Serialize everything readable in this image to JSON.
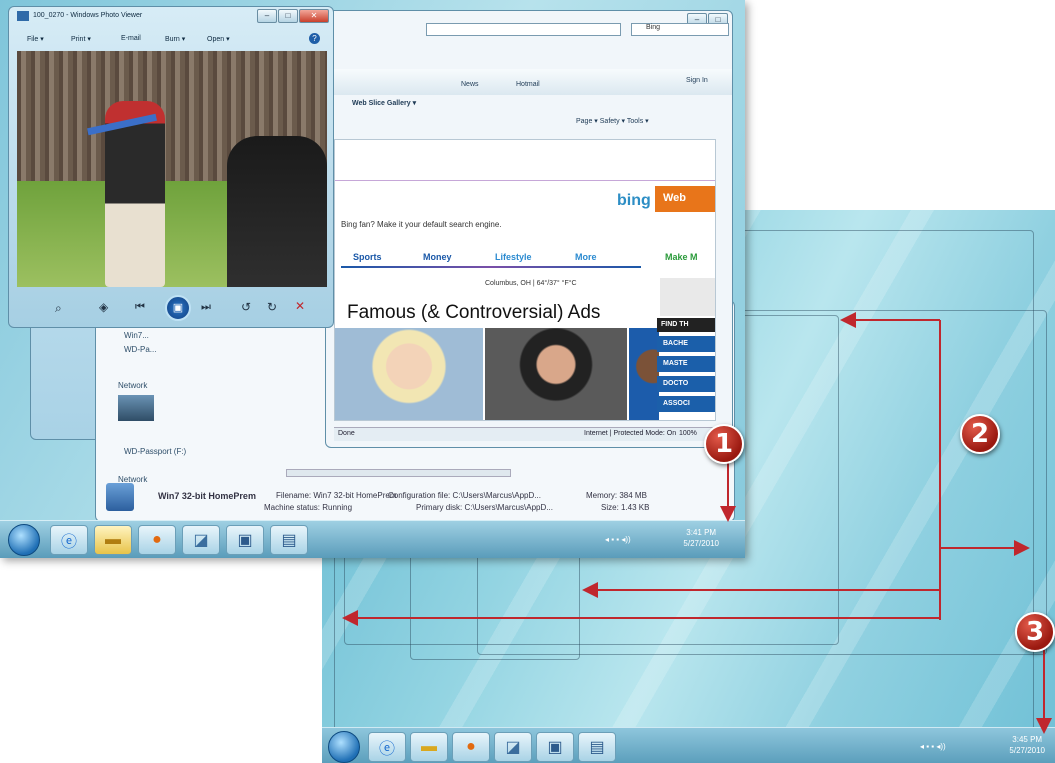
{
  "photo_viewer": {
    "title": "100_0270 - Windows Photo Viewer",
    "menu": [
      "File ▾",
      "Print ▾",
      "E-mail",
      "Burn ▾",
      "Open ▾"
    ]
  },
  "ie": {
    "address": "",
    "search_text": "Bing",
    "toolbar1": [
      "News",
      "Hotmail"
    ],
    "signin": "Sign In",
    "favorites_label": "Web Slice Gallery ▾",
    "command_bar": "Page ▾  Safety ▾  Tools ▾",
    "bing_logo": "bing",
    "web_button": "Web",
    "tagline": "Bing fan? Make it your default search engine.",
    "nav": [
      "Sports",
      "Money",
      "Lifestyle",
      "More",
      "Make M"
    ],
    "weather": "Columbus, OH |  64°/37° °F°C",
    "headline": "Famous (& Controversial) Ads",
    "find_label": "FIND TH",
    "sidebar_buttons": [
      "BACHE",
      "MASTE",
      "DOCTO",
      "ASSOCI"
    ],
    "status_left": "Done",
    "status_zone": "Internet | Protected Mode: On",
    "zoom": "100%"
  },
  "explorer": {
    "items": [
      "Win7...",
      "WD-Pa...",
      "Network",
      "WD-Passport (F:)",
      "Network"
    ],
    "detail_name": "Win7 32-bit HomePrem",
    "detail_fields": [
      "Filename: Win7 32-bit HomePrem",
      "Machine status: Running",
      "Configuration file: C:\\Users\\Marcus\\AppD...",
      "Primary disk: C:\\Users\\Marcus\\AppD...",
      "Memory: 384 MB",
      "Size: 1.43 KB"
    ]
  },
  "front_clock": {
    "time": "3:41 PM",
    "date": "5/27/2010"
  },
  "rear_clock": {
    "time": "3:45 PM",
    "date": "5/27/2010"
  },
  "callouts": [
    "1",
    "2",
    "3"
  ],
  "colors": {
    "callout_red": "#b3231a",
    "arrow_red": "#c0272d",
    "aero_blue": "#7fc5da"
  }
}
